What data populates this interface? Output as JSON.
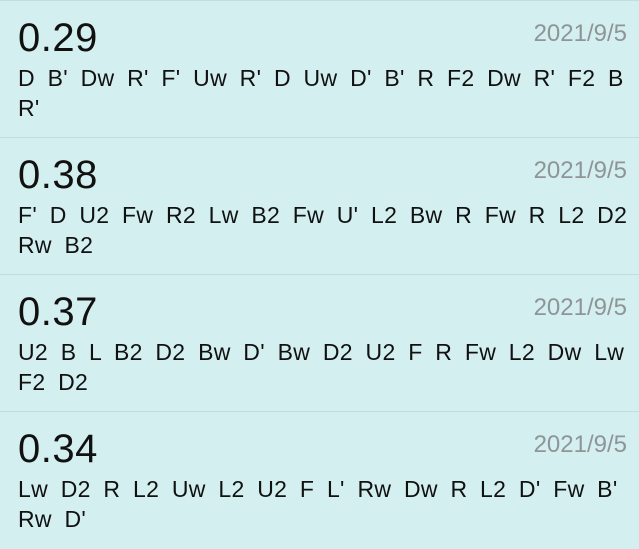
{
  "solves": [
    {
      "time": "0.29",
      "date": "2021/9/5",
      "scramble": "D B' Dw R' F' Uw R' D Uw D' B' R F2 Dw R' F2 B R'"
    },
    {
      "time": "0.38",
      "date": "2021/9/5",
      "scramble": "F' D U2 Fw R2 Lw B2 Fw U' L2 Bw R Fw R L2 D2 Rw B2"
    },
    {
      "time": "0.37",
      "date": "2021/9/5",
      "scramble": "U2 B L B2 D2 Bw D' Bw D2 U2 F R Fw L2 Dw Lw F2 D2"
    },
    {
      "time": "0.34",
      "date": "2021/9/5",
      "scramble": "Lw D2 R L2 Uw L2 U2 F L' Rw Dw R L2 D' Fw B' Rw D'"
    }
  ]
}
